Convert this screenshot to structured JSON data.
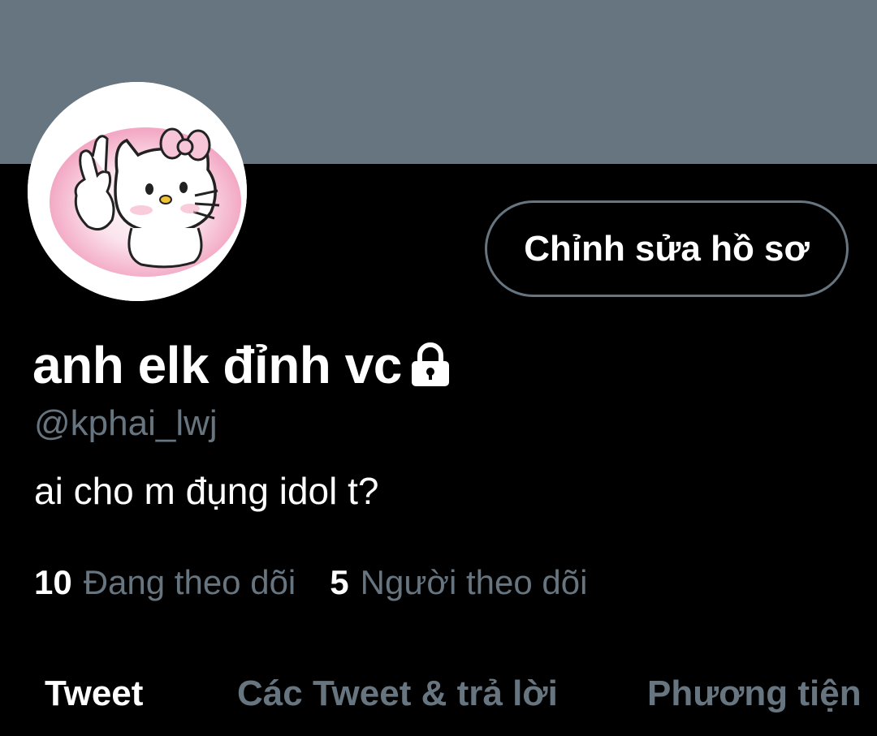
{
  "profile": {
    "display_name": "anh elk đỉnh vc",
    "handle": "@kphai_lwj",
    "bio": "ai cho m đụng idol t?",
    "protected_icon": "lock-icon",
    "avatar_icon": "hello-kitty-avatar"
  },
  "actions": {
    "edit_profile_label": "Chỉnh sửa hồ sơ"
  },
  "stats": {
    "following_count": "10",
    "following_label": "Đang theo dõi",
    "followers_count": "5",
    "followers_label": "Người theo dõi"
  },
  "tabs": [
    {
      "label": "Tweet",
      "active": true
    },
    {
      "label": "Các Tweet & trả lời",
      "active": false
    },
    {
      "label": "Phương tiện",
      "active": false
    }
  ],
  "colors": {
    "background": "#000000",
    "banner": "#66757f",
    "primary_text": "#ffffff",
    "secondary_text": "#66757f"
  }
}
